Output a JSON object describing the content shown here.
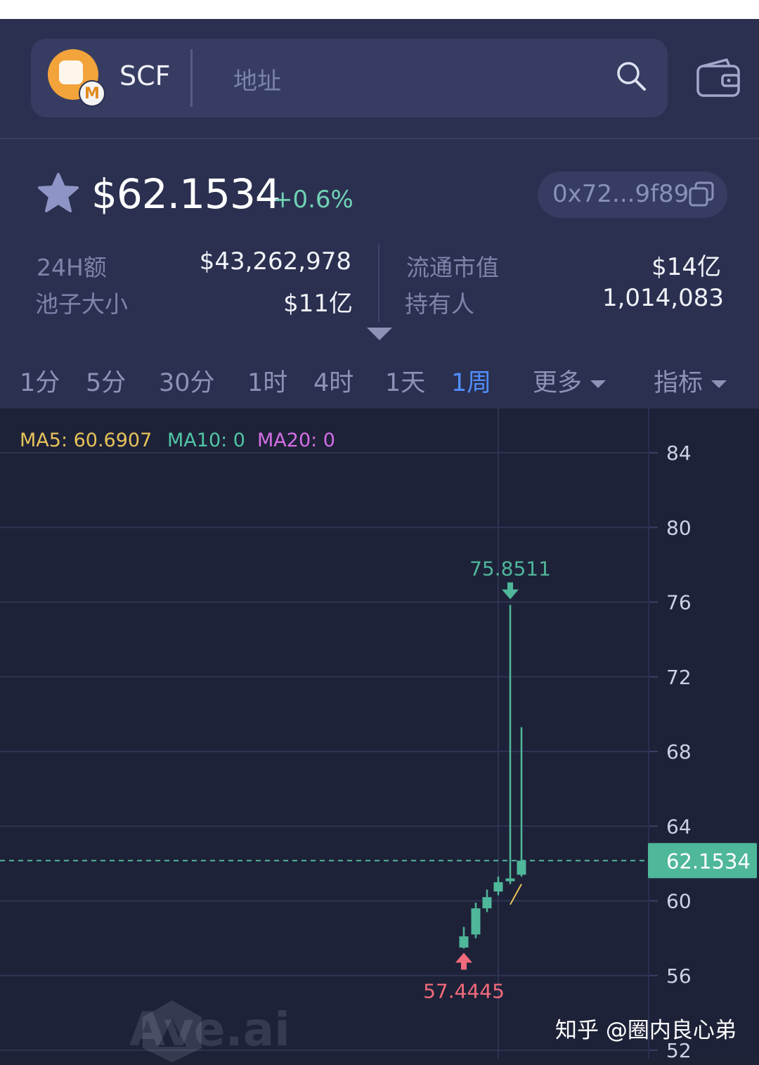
{
  "header": {
    "token_symbol": "SCF",
    "logo_badge": "M",
    "search_placeholder": "地址"
  },
  "token_info": {
    "price": "$62.1534",
    "change": "+0.6%",
    "contract_address": "0x72...9f89",
    "stats_left": [
      {
        "label": "24H额",
        "value": "$43,262,978"
      },
      {
        "label": "池子大小",
        "value": "$11亿"
      }
    ],
    "stats_right": [
      {
        "label": "流通市值",
        "value": "$14亿"
      },
      {
        "label": "持有人",
        "value": "1,014,083"
      }
    ]
  },
  "timeframes": [
    "1分",
    "5分",
    "30分",
    "1时",
    "4时",
    "1天",
    "1周",
    "更多",
    "指标"
  ],
  "active_timeframe": "1周",
  "indicators": {
    "ma5": "MA5: 60.6907",
    "ma10": "MA10: 0",
    "ma20": "MA20: 0"
  },
  "colors": {
    "up": "#4fb79a",
    "down": "#f06b7b",
    "accent": "#4f8eff",
    "ma5": "#e7c35a",
    "ma10": "#4fc7a4",
    "ma20": "#d46ee6"
  },
  "watermark": "Ave.ai",
  "credit": "知乎 @圈内良心弟",
  "chart_data": {
    "type": "candlestick",
    "y_axis_ticks": [
      84,
      80,
      76,
      72,
      68,
      64,
      60,
      56,
      52
    ],
    "ylim": [
      52,
      84
    ],
    "current_price": 62.1534,
    "current_price_label": "62.1534",
    "high_label": "75.8511",
    "low_label": "57.4445",
    "high_value": 75.8511,
    "low_value": 57.4445,
    "candles": [
      {
        "open": 57.5,
        "close": 58.1,
        "high": 58.6,
        "low": 57.4445
      },
      {
        "open": 58.2,
        "close": 59.6,
        "high": 59.9,
        "low": 58.0
      },
      {
        "open": 59.6,
        "close": 60.2,
        "high": 60.6,
        "low": 59.4
      },
      {
        "open": 60.5,
        "close": 61.0,
        "high": 61.3,
        "low": 60.3
      },
      {
        "open": 61.1,
        "close": 61.2,
        "high": 75.8511,
        "low": 60.9
      },
      {
        "open": 61.4,
        "close": 62.1534,
        "high": 69.3,
        "low": 61.3
      }
    ]
  }
}
